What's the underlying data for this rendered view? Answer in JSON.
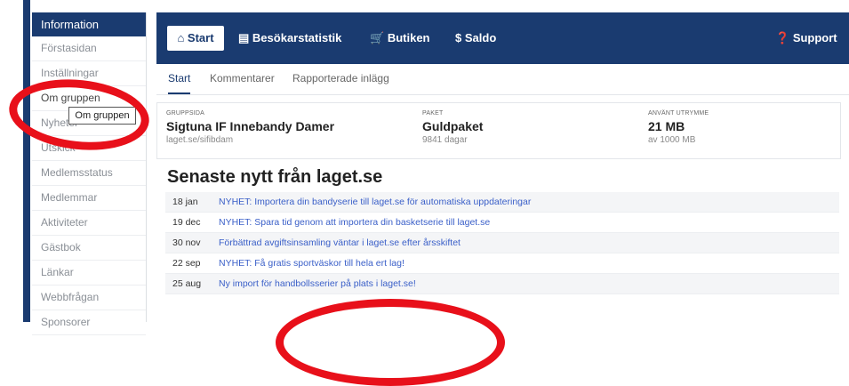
{
  "sidebar": {
    "header": "Information",
    "items": [
      {
        "label": "Förstasidan"
      },
      {
        "label": "Inställningar"
      },
      {
        "label": "Om gruppen"
      },
      {
        "label": "Nyheter"
      },
      {
        "label": "Utskick"
      },
      {
        "label": "Medlemsstatus"
      },
      {
        "label": "Medlemmar"
      },
      {
        "label": "Aktiviteter"
      },
      {
        "label": "Gästbok"
      },
      {
        "label": "Länkar"
      },
      {
        "label": "Webbfrågan"
      },
      {
        "label": "Sponsorer"
      }
    ],
    "tooltip": "Om gruppen"
  },
  "topnav": {
    "start": "Start",
    "visitor_stats": "Besökarstatistik",
    "shop": "Butiken",
    "balance": "Saldo",
    "support": "Support"
  },
  "tabs": [
    "Start",
    "Kommentarer",
    "Rapporterade inlägg"
  ],
  "info": {
    "group": {
      "label": "GRUPPSIDA",
      "value": "Sigtuna IF Innebandy Damer",
      "sub": "laget.se/sifibdam"
    },
    "package": {
      "label": "PAKET",
      "value": "Guldpaket",
      "sub": "9841 dagar"
    },
    "storage": {
      "label": "ANVÄNT UTRYMME",
      "value": "21 MB",
      "sub": "av 1000 MB"
    }
  },
  "news": {
    "heading": "Senaste nytt från laget.se",
    "items": [
      {
        "date": "18 jan",
        "text": "NYHET: Importera din bandyserie till laget.se för automatiska uppdateringar"
      },
      {
        "date": "19 dec",
        "text": "NYHET: Spara tid genom att importera din basketserie till laget.se"
      },
      {
        "date": "30 nov",
        "text": "Förbättrad avgiftsinsamling väntar i laget.se efter årsskiftet"
      },
      {
        "date": "22 sep",
        "text": "NYHET: Få gratis sportväskor till hela ert lag!"
      },
      {
        "date": "25 aug",
        "text": "Ny import för handbollsserier på plats i laget.se!"
      }
    ]
  },
  "colors": {
    "navy": "#1a3b70",
    "link": "#3a5fc8",
    "annotation": "#e8101a"
  }
}
